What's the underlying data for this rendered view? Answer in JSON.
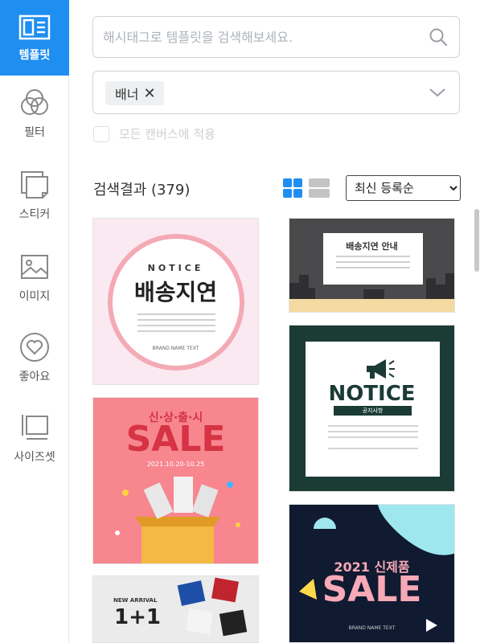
{
  "sidebar": {
    "items": [
      {
        "label": "템플릿",
        "icon": "template-icon",
        "active": true
      },
      {
        "label": "필터",
        "icon": "filter-icon"
      },
      {
        "label": "스티커",
        "icon": "sticker-icon"
      },
      {
        "label": "이미지",
        "icon": "image-icon"
      },
      {
        "label": "좋아요",
        "icon": "heart-icon"
      },
      {
        "label": "사이즈셋",
        "icon": "size-icon"
      }
    ],
    "accent": "#1f8ef1"
  },
  "search": {
    "placeholder": "해시태그로 템플릿을 검색해보세요.",
    "value": ""
  },
  "filter": {
    "chip_label": "배너",
    "chip_close": "✕"
  },
  "apply_all": {
    "label": "모든 캔버스에 적용",
    "checked": false
  },
  "results": {
    "title": "검색결과 (379)"
  },
  "sort": {
    "selected": "최신 등록순",
    "options": [
      "최신 등록순"
    ]
  },
  "templates": {
    "card1": {
      "small": "NOTICE",
      "title": "배송지연",
      "brand": "BRAND NAME TEXT"
    },
    "card2": {
      "small": "신·상·출·시",
      "title": "SALE",
      "date": "2021.10.20-10.25"
    },
    "card3": {
      "small": "NEW ARRIVAL",
      "title": "1+1"
    },
    "card4": {
      "title": "배송지연 안내"
    },
    "card5": {
      "title": "NOTICE",
      "sub": "공지사항"
    },
    "card6": {
      "small": "2021 신제품",
      "title": "SALE",
      "brand": "BRAND NAME TEXT"
    }
  }
}
